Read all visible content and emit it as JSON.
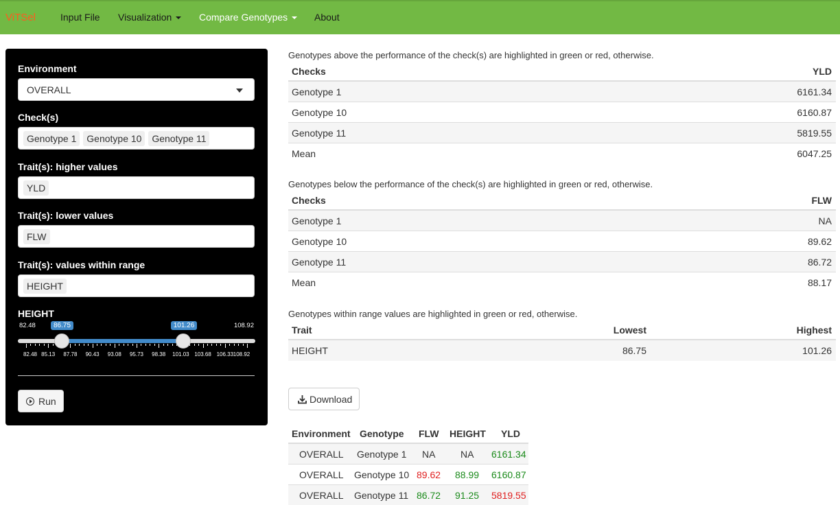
{
  "navbar": {
    "brand": "ViTSel",
    "items": [
      {
        "label": "Input File"
      },
      {
        "label": "Visualization"
      },
      {
        "label": "Compare Genotypes"
      },
      {
        "label": "About"
      }
    ]
  },
  "sidebar": {
    "environment_label": "Environment",
    "environment_value": "OVERALL",
    "checks_label": "Check(s)",
    "checks": [
      "Genotype 1",
      "Genotype 10",
      "Genotype 11"
    ],
    "higher_label": "Trait(s): higher values",
    "higher_chips": [
      "YLD"
    ],
    "lower_label": "Trait(s): lower values",
    "lower_chips": [
      "FLW"
    ],
    "range_label": "Trait(s): values within range",
    "range_chips": [
      "HEIGHT"
    ],
    "slider": {
      "label": "HEIGHT",
      "min_label": "82.48",
      "max_label": "108.92",
      "from_label": "86.75",
      "to_label": "101.26",
      "min": 82.48,
      "max": 108.92,
      "from": 86.75,
      "to": 101.26,
      "ticks": [
        "82.48",
        "85.13",
        "87.78",
        "90.43",
        "93.08",
        "95.73",
        "98.38",
        "101.03",
        "103.68",
        "106.33",
        "108.92"
      ]
    },
    "run_label": "Run"
  },
  "main": {
    "higher_caption": "Genotypes above the performance of the check(s) are highlighted in green or red, otherwise.",
    "higher_table": {
      "headers": [
        "Checks",
        "YLD"
      ],
      "rows": [
        [
          "Genotype 1",
          "6161.34"
        ],
        [
          "Genotype 10",
          "6160.87"
        ],
        [
          "Genotype 11",
          "5819.55"
        ],
        [
          "Mean",
          "6047.25"
        ]
      ]
    },
    "lower_caption": "Genotypes below the performance of the check(s) are highlighted in green or red, otherwise.",
    "lower_table": {
      "headers": [
        "Checks",
        "FLW"
      ],
      "rows": [
        [
          "Genotype 1",
          "NA"
        ],
        [
          "Genotype 10",
          "89.62"
        ],
        [
          "Genotype 11",
          "86.72"
        ],
        [
          "Mean",
          "88.17"
        ]
      ]
    },
    "range_caption": "Genotypes within range values are highlighted in green or red, otherwise.",
    "range_table": {
      "headers": [
        "Trait",
        "Lowest",
        "Highest"
      ],
      "rows": [
        [
          "HEIGHT",
          "86.75",
          "101.26"
        ]
      ]
    },
    "download_label": "Download",
    "results": {
      "headers": [
        "Environment",
        "Genotype",
        "FLW",
        "HEIGHT",
        "YLD"
      ],
      "rows": [
        [
          "OVERALL",
          "Genotype 1",
          "NA",
          "NA",
          "6161.34"
        ],
        [
          "OVERALL",
          "Genotype 10",
          "89.62",
          "88.99",
          "6160.87"
        ],
        [
          "OVERALL",
          "Genotype 11",
          "86.72",
          "91.25",
          "5819.55"
        ]
      ],
      "colors": [
        [
          "",
          "",
          "",
          "",
          "green"
        ],
        [
          "",
          "",
          "red",
          "green",
          "green"
        ],
        [
          "",
          "",
          "green",
          "green",
          "red"
        ]
      ]
    }
  }
}
